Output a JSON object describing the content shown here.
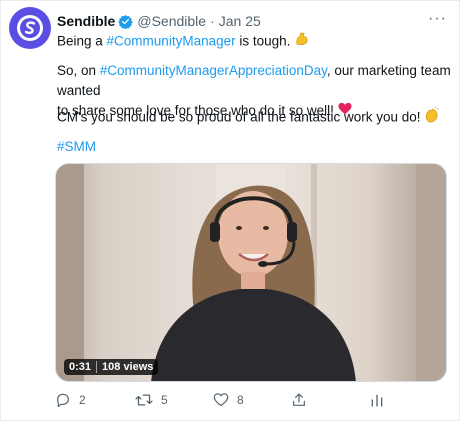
{
  "tweet": {
    "author_name": "Sendible",
    "handle": "@Sendible",
    "separator": "·",
    "date": "Jan 25",
    "more_label": "···",
    "line1_prefix": "Being a ",
    "line1_hashtag": "#CommunityManager",
    "line1_suffix": " is tough.",
    "line1_emoji": "💪",
    "para2_prefix": "So, on ",
    "para2_hashtag": "#CommunityManagerAppreciationDay",
    "para2_line1_suffix": ", our marketing team wanted",
    "para2_line2": "to share some love for those who do it so well!",
    "para2_emoji": "❤️",
    "para3": "CM's you should be so proud of all the fantastic work you do!",
    "para3_emoji": "👏",
    "hashtag_line": "#SMM"
  },
  "video": {
    "duration": "0:31",
    "views": "108 views"
  },
  "actions": {
    "replies": "2",
    "retweets": "5",
    "likes": "8"
  },
  "colors": {
    "link": "#1d9bf0",
    "avatar_bg": "#5b4ee5",
    "muted": "#536471"
  }
}
